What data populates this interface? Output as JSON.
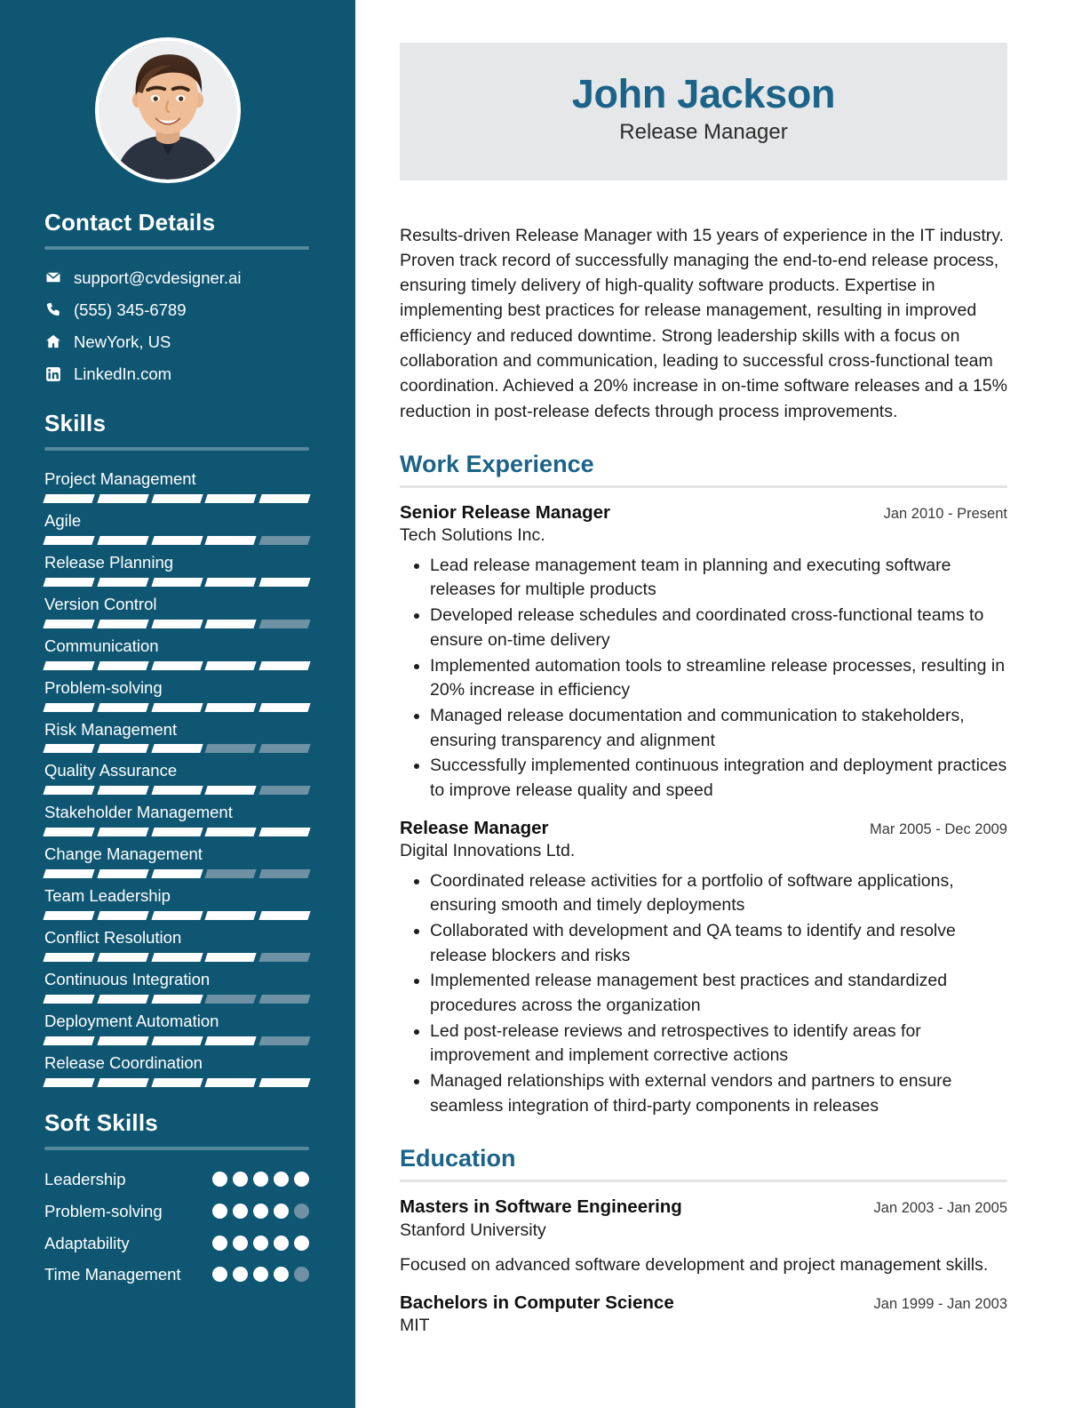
{
  "colors": {
    "sidebar_bg": "#0F5672",
    "accent": "#1B6388",
    "name_card_bg": "#e6e7e8",
    "skill_on": "#ffffff",
    "skill_off": "#6E91A3"
  },
  "sidebar": {
    "avatar": {
      "icon": "profile-photo",
      "alt": "Profile photo"
    },
    "contact": {
      "heading": "Contact Details",
      "items": [
        {
          "icon": "envelope-icon",
          "text": "support@cvdesigner.ai"
        },
        {
          "icon": "phone-icon",
          "text": "(555) 345-6789"
        },
        {
          "icon": "home-icon",
          "text": "NewYork, US"
        },
        {
          "icon": "linkedin-icon",
          "text": "LinkedIn.com"
        }
      ]
    },
    "skills": {
      "heading": "Skills",
      "max": 5,
      "items": [
        {
          "label": "Project Management",
          "level": 5
        },
        {
          "label": "Agile",
          "level": 4
        },
        {
          "label": "Release Planning",
          "level": 5
        },
        {
          "label": "Version Control",
          "level": 4
        },
        {
          "label": "Communication",
          "level": 5
        },
        {
          "label": "Problem-solving",
          "level": 5
        },
        {
          "label": "Risk Management",
          "level": 3
        },
        {
          "label": "Quality Assurance",
          "level": 4
        },
        {
          "label": "Stakeholder Management",
          "level": 5
        },
        {
          "label": "Change Management",
          "level": 3
        },
        {
          "label": "Team Leadership",
          "level": 5
        },
        {
          "label": "Conflict Resolution",
          "level": 4
        },
        {
          "label": "Continuous Integration",
          "level": 3
        },
        {
          "label": "Deployment Automation",
          "level": 4
        },
        {
          "label": "Release Coordination",
          "level": 5
        }
      ]
    },
    "soft_skills": {
      "heading": "Soft Skills",
      "max": 5,
      "items": [
        {
          "label": "Leadership",
          "level": 5
        },
        {
          "label": "Problem-solving",
          "level": 4
        },
        {
          "label": "Adaptability",
          "level": 5
        },
        {
          "label": "Time Management",
          "level": 4
        }
      ]
    }
  },
  "main": {
    "header": {
      "name": "John Jackson",
      "title": "Release Manager"
    },
    "summary": "Results-driven Release Manager with 15 years of experience in the IT industry. Proven track record of successfully managing the end-to-end release process, ensuring timely delivery of high-quality software products. Expertise in implementing best practices for release management, resulting in improved efficiency and reduced downtime. Strong leadership skills with a focus on collaboration and communication, leading to successful cross-functional team coordination. Achieved a 20% increase in on-time software releases and a 15% reduction in post-release defects through process improvements.",
    "work": {
      "heading": "Work Experience",
      "entries": [
        {
          "role": "Senior Release Manager",
          "date": "Jan 2010 - Present",
          "org": "Tech Solutions Inc.",
          "bullets": [
            "Lead release management team in planning and executing software releases for multiple products",
            "Developed release schedules and coordinated cross-functional teams to ensure on-time delivery",
            "Implemented automation tools to streamline release processes, resulting in 20% increase in efficiency",
            "Managed release documentation and communication to stakeholders, ensuring transparency and alignment",
            "Successfully implemented continuous integration and deployment practices to improve release quality and speed"
          ]
        },
        {
          "role": "Release Manager",
          "date": "Mar 2005 - Dec 2009",
          "org": "Digital Innovations Ltd.",
          "bullets": [
            "Coordinated release activities for a portfolio of software applications, ensuring smooth and timely deployments",
            "Collaborated with development and QA teams to identify and resolve release blockers and risks",
            "Implemented release management best practices and standardized procedures across the organization",
            "Led post-release reviews and retrospectives to identify areas for improvement and implement corrective actions",
            "Managed relationships with external vendors and partners to ensure seamless integration of third-party components in releases"
          ]
        }
      ]
    },
    "education": {
      "heading": "Education",
      "entries": [
        {
          "degree": "Masters in Software Engineering",
          "date": "Jan 2003 - Jan 2005",
          "school": "Stanford University",
          "description": "Focused on advanced software development and project management skills."
        },
        {
          "degree": "Bachelors in Computer Science",
          "date": "Jan 1999 - Jan 2003",
          "school": "MIT",
          "description": ""
        }
      ]
    }
  }
}
